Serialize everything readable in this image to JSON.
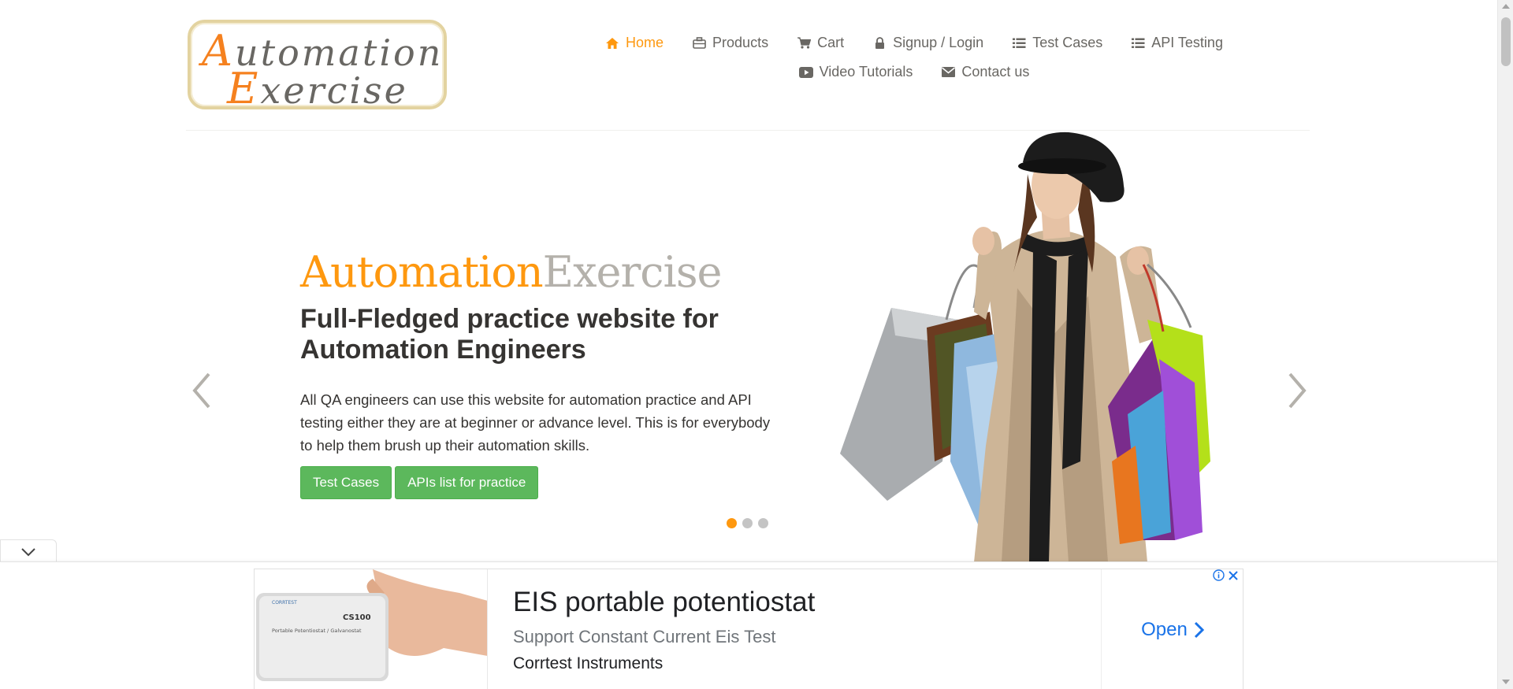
{
  "header": {
    "logo": {
      "line1_cap": "A",
      "line1_rest": "utomation",
      "line2_cap": "E",
      "line2_rest": "xercise"
    },
    "nav": [
      {
        "label": "Home",
        "icon": "home-icon",
        "active": true
      },
      {
        "label": "Products",
        "icon": "briefcase-icon",
        "active": false
      },
      {
        "label": "Cart",
        "icon": "cart-icon",
        "active": false
      },
      {
        "label": "Signup / Login",
        "icon": "lock-icon",
        "active": false
      },
      {
        "label": "Test Cases",
        "icon": "list-icon",
        "active": false
      },
      {
        "label": "API Testing",
        "icon": "list-icon",
        "active": false
      },
      {
        "label": "Video Tutorials",
        "icon": "youtube-play-icon",
        "active": false
      },
      {
        "label": "Contact us",
        "icon": "envelope-icon",
        "active": false
      }
    ]
  },
  "slider": {
    "brand_part1": "Automation",
    "brand_part2": "Exercise",
    "headline": "Full-Fledged practice website for Automation Engineers",
    "description": "All QA engineers can use this website for automation practice and API testing either they are at beginner or advance level. This is for everybody to help them brush up their automation skills.",
    "buttons": {
      "test_cases": "Test Cases",
      "apis_list": "APIs list for practice"
    },
    "active_slide": 1,
    "slide_count": 3,
    "image": "girl-with-shopping-bags"
  },
  "ad": {
    "title": "EIS portable potentiostat",
    "subtitle": "Support Constant Current Eis Test",
    "advertiser": "Corrtest Instruments",
    "cta": "Open",
    "product_label": "CS100",
    "product_caption": "Portable Potentiostat / Galvanostat",
    "product_brand": "CORRTEST"
  },
  "colors": {
    "accent": "#fe980f",
    "button_green": "#5cb85c",
    "text_dark": "#363432",
    "text_muted": "#696763",
    "ad_link": "#1a73e8"
  }
}
